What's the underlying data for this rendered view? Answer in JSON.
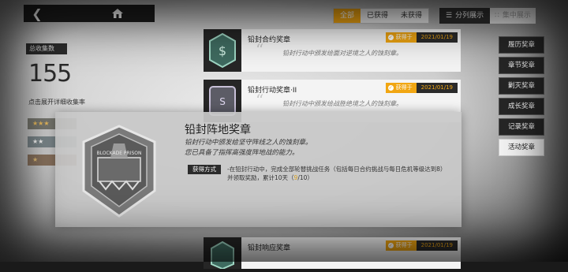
{
  "topbar": {
    "back_icon": "back-arrow-icon",
    "home_icon": "home-icon"
  },
  "filters": [
    {
      "label": "全部",
      "active": true
    },
    {
      "label": "已获得",
      "active": false
    },
    {
      "label": "未获得",
      "active": false
    }
  ],
  "view": {
    "split_label": "分列展示",
    "focus_label": "集中展示"
  },
  "stats": {
    "tag": "总收集数",
    "total": "155",
    "hint": "点击展开详细收集率",
    "rows": [
      {
        "stars": "★★★"
      },
      {
        "stars": "★★"
      },
      {
        "stars": "★"
      }
    ]
  },
  "cards": [
    {
      "title": "铅封合约奖章",
      "desc": "铅封行动中颁发给面对逆境之人的蚀刻章。",
      "status": "获得于",
      "date": "2021/01/19"
    },
    {
      "title": "铅封行动奖章·II",
      "desc": "铅封行动中颁发给战胜绝境之人的蚀刻章。",
      "status": "获得于",
      "date": "2021/01/19"
    },
    {
      "title": "铅封响应奖章",
      "desc": "",
      "status": "获得于",
      "date": "2021/01/19"
    }
  ],
  "side_menu": [
    {
      "label": "履历奖章",
      "active": false
    },
    {
      "label": "章节奖章",
      "active": false
    },
    {
      "label": "剿灭奖章",
      "active": false
    },
    {
      "label": "成长奖章",
      "active": false
    },
    {
      "label": "记录奖章",
      "active": false
    },
    {
      "label": "活动奖章",
      "active": true
    }
  ],
  "popup": {
    "title": "铅封阵地奖章",
    "desc1": "铅封行动中颁发给坚守阵线之人的蚀刻章。",
    "desc2": "您已具备了指挥高强度阵地战的能力。",
    "method_label": "获得方式",
    "method_text": "-在铅封行动中，完成全部轮替挑战任务（包括每日合约挑战与每日危机等级达到8）并领取奖励，累计10天",
    "progress_current": "9",
    "progress_total": "/10",
    "progress_open": "（",
    "progress_close": "）",
    "medal_text": "BLOCKADE PRISON"
  },
  "colors": {
    "accent": "#f1a612",
    "dark": "#262626"
  }
}
